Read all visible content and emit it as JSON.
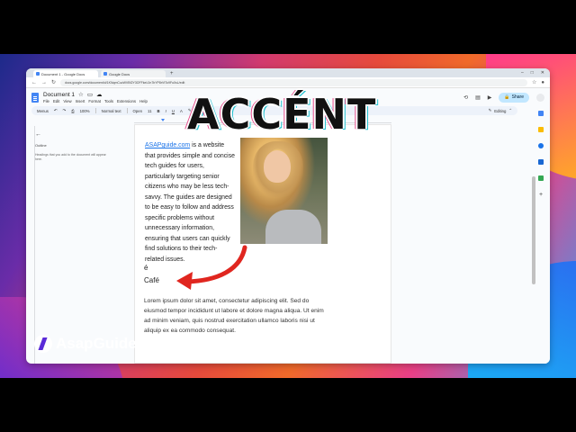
{
  "browser": {
    "tabs": [
      {
        "label": "Document 1 - Google Docs",
        "active": true
      },
      {
        "label": "Google Docs",
        "active": false
      }
    ],
    "url": "docs.google.com/document/d/1KNqmCuzWVBf2Y3OFFkeL0n7bYP8rVtTo9Fu0sL/edit"
  },
  "doc": {
    "title": "Document 1",
    "menus": [
      "File",
      "Edit",
      "View",
      "Insert",
      "Format",
      "Tools",
      "Extensions",
      "Help"
    ],
    "share_label": "Share"
  },
  "toolbar": {
    "search": "Menus",
    "zoom": "100%",
    "style": "Normal text",
    "font": "Open",
    "font_size": "11",
    "editing_label": "Editing"
  },
  "outline": {
    "title": "Outline",
    "hint": "Headings that you add to the document will appear here."
  },
  "content": {
    "link_text": "ASAPguide.com",
    "paragraph": " is a website that provides simple and concise tech guides for users, particularly targeting senior citizens who may be less tech-savvy. The guides are designed to be easy to follow and address specific problems without unnecessary information, ensuring that users can quickly find solutions to their tech-related issues.",
    "accent_char": "é",
    "cafe_word": "Café",
    "lorem": "Lorem ipsum dolor sit amet, consectetur adipiscing elit. Sed do eiusmod tempor incididunt ut labore et dolore magna aliqua. Ut enim ad minim veniam, quis nostrud exercitation ullamco laboris nisi ut aliquip ex ea commodo consequat."
  },
  "overlay": {
    "title": "ACCÉNT",
    "brand": "AsapGuide"
  },
  "colors": {
    "accent_blue": "#1a73e8",
    "share_bg": "#c2e7ff",
    "arrow_red": "#e0261f"
  }
}
